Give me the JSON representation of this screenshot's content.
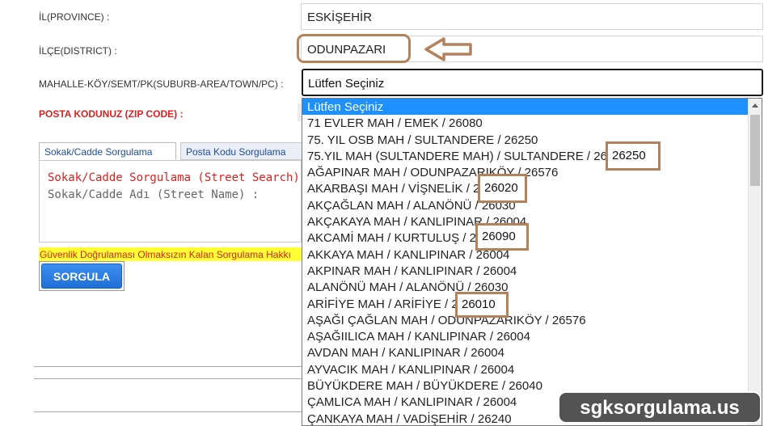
{
  "form": {
    "province_label": "İL(PROVINCE) :",
    "province_value": "ESKİŞEHİR",
    "district_label": "İLÇE(DISTRICT) :",
    "district_value": "ODUNPAZARI",
    "mahalle_label": "MAHALLE-KÖY/SEMT/PK(SUBURB-AREA/TOWN/PC) :",
    "mahalle_selected": "Lütfen Seçiniz",
    "zip_label": "POSTA KODUNUZ (ZIP CODE) :"
  },
  "tabs": [
    {
      "label": "Sokak/Cadde Sorgulama"
    },
    {
      "label": "Posta Kodu Sorgulama"
    }
  ],
  "panel": {
    "title": "Sokak/Cadde Sorgulama (Street Search)",
    "field_label": "Sokak/Cadde Adı (Street Name) :"
  },
  "warning_text": "Güvenlik Doğrulaması Olmaksızın Kalan Sorgulama Hakkı",
  "submit_label": "SORGULA",
  "dropdown": {
    "options": [
      "Lütfen Seçiniz",
      "71 EVLER MAH / EMEK / 26080",
      "75. YIL OSB MAH / SULTANDERE / 26250",
      "75.YIL MAH (SULTANDERE MAH) / SULTANDERE / 26250",
      "AĞAPINAR MAH / ODUNPAZARIKÖY / 26576",
      "AKARBAŞI MAH / VİŞNELİK / 26020",
      "AKÇAĞLAN MAH / ALANÖNÜ / 26030",
      "AKÇAKAYA MAH / KANLIPINAR / 26004",
      "AKCAMİ MAH / KURTULUŞ / 26090",
      "AKKAYA MAH / KANLIPINAR / 26004",
      "AKPINAR MAH / KANLIPINAR / 26004",
      "ALANÖNÜ MAH / ALANÖNÜ / 26030",
      "ARİFİYE MAH / ARİFİYE / 26010",
      "AŞAĞI ÇAĞLAN MAH / ODUNPAZARIKÖY / 26576",
      "AŞAĞIILICA MAH / KANLIPINAR / 26004",
      "AVDAN MAH / KANLIPINAR / 26004",
      "AYVACIK MAH / KANLIPINAR / 26004",
      "BÜYÜKDERE MAH / BÜYÜKDERE / 26040",
      "ÇAMLICA MAH / KANLIPINAR / 26004",
      "ÇANKAYA MAH / VADİŞEHİR / 26240"
    ],
    "selected_index": 0
  },
  "zip_highlights": [
    "26250",
    "26020",
    "26090",
    "26010"
  ],
  "watermark": "sgksorgulama.us",
  "colors": {
    "highlight_border": "#b4825a",
    "selected_option": "#1e90ff",
    "error_red": "#e02020",
    "warning_bg": "#ffff33",
    "button_blue": "#1f6fd6"
  }
}
